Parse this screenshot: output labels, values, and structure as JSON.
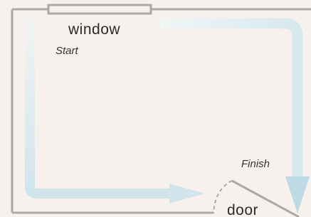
{
  "labels": {
    "window": "window",
    "start": "Start",
    "finish": "Finish",
    "door": "door"
  },
  "colors": {
    "background": "#f7f1ee",
    "walls": "#a9a9a9",
    "path": "#cfe4ec",
    "path_light": "#e6f0f2",
    "door_swing": "#a9a9a9"
  },
  "icons": {
    "start_path": "arrow-path-down-right",
    "finish_path": "arrow-path-right-down"
  }
}
